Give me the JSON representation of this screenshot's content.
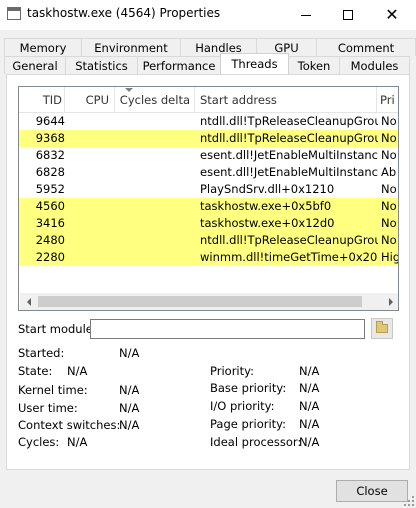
{
  "window": {
    "title": "taskhostw.exe (4564) Properties",
    "icon": "app-window-icon"
  },
  "tabs_row1": [
    "Memory",
    "Environment",
    "Handles",
    "GPU",
    "Comment"
  ],
  "tabs_row2": [
    "General",
    "Statistics",
    "Performance",
    "Threads",
    "Token",
    "Modules"
  ],
  "active_tab": "Threads",
  "threads": {
    "columns": [
      "TID",
      "CPU",
      "Cycles delta",
      "Start address",
      "Pri"
    ],
    "highlight_color": "#ffff80",
    "rows": [
      {
        "tid": "9644",
        "address": "ntdll.dll!TpReleaseCleanupGroup...",
        "priority": "No",
        "highlight": false
      },
      {
        "tid": "9368",
        "address": "ntdll.dll!TpReleaseCleanupGroup...",
        "priority": "No",
        "highlight": true
      },
      {
        "tid": "6832",
        "address": "esent.dll!JetEnableMultiInstance...",
        "priority": "No",
        "highlight": false
      },
      {
        "tid": "6828",
        "address": "esent.dll!JetEnableMultiInstance...",
        "priority": "Ab",
        "highlight": false
      },
      {
        "tid": "5952",
        "address": "PlaySndSrv.dll+0x1210",
        "priority": "No",
        "highlight": false
      },
      {
        "tid": "4560",
        "address": "taskhostw.exe+0x5bf0",
        "priority": "No",
        "highlight": true
      },
      {
        "tid": "3416",
        "address": "taskhostw.exe+0x12d0",
        "priority": "No",
        "highlight": true
      },
      {
        "tid": "2480",
        "address": "ntdll.dll!TpReleaseCleanupGroup...",
        "priority": "No",
        "highlight": true
      },
      {
        "tid": "2280",
        "address": "winmm.dll!timeGetTime+0x20",
        "priority": "Hig",
        "highlight": true
      }
    ]
  },
  "start_module": {
    "label": "Start module:",
    "value": ""
  },
  "details_left": [
    {
      "label": "Started:",
      "value": "N/A"
    },
    {
      "label": "State:",
      "value": "N/A"
    },
    {
      "label": "Kernel time:",
      "value": "N/A"
    },
    {
      "label": "User time:",
      "value": "N/A"
    },
    {
      "label": "Context switches:",
      "value": "N/A"
    },
    {
      "label": "Cycles:",
      "value": "N/A"
    }
  ],
  "details_right": [
    {
      "label": "Priority:",
      "value": "N/A"
    },
    {
      "label": "Base priority:",
      "value": "N/A"
    },
    {
      "label": "I/O priority:",
      "value": "N/A"
    },
    {
      "label": "Page priority:",
      "value": "N/A"
    },
    {
      "label": "Ideal processor:",
      "value": "N/A"
    }
  ],
  "close_label": "Close"
}
